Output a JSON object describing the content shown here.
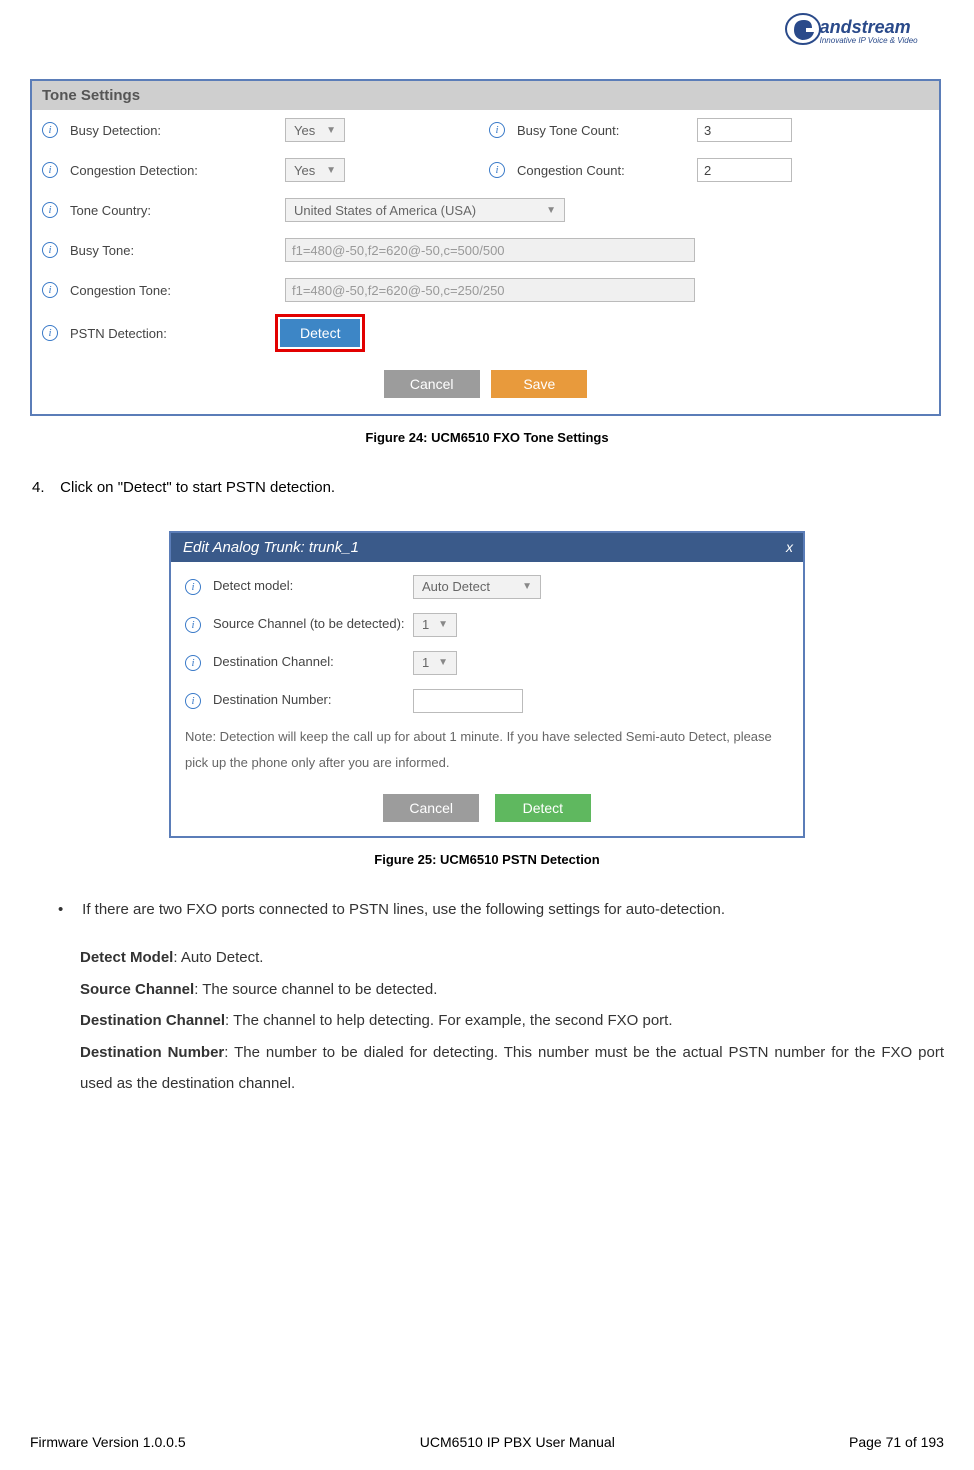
{
  "logo": {
    "brand": "andstream",
    "tagline": "Innovative IP Voice & Video"
  },
  "panel1": {
    "title": "Tone Settings",
    "rows": {
      "busy_detection": {
        "label": "Busy Detection:",
        "value": "Yes"
      },
      "busy_tone_count": {
        "label": "Busy Tone Count:",
        "value": "3"
      },
      "congestion_detection": {
        "label": "Congestion Detection:",
        "value": "Yes"
      },
      "congestion_count": {
        "label": "Congestion Count:",
        "value": "2"
      },
      "tone_country": {
        "label": "Tone Country:",
        "value": "United States of America (USA)"
      },
      "busy_tone": {
        "label": "Busy Tone:",
        "value": "f1=480@-50,f2=620@-50,c=500/500"
      },
      "congestion_tone": {
        "label": "Congestion Tone:",
        "value": "f1=480@-50,f2=620@-50,c=250/250"
      },
      "pstn_detection": {
        "label": "PSTN Detection:",
        "button": "Detect"
      }
    },
    "actions": {
      "cancel": "Cancel",
      "save": "Save"
    }
  },
  "fig24": "Figure 24: UCM6510 FXO Tone Settings",
  "instruction4": {
    "num": "4.",
    "text": "Click on \"Detect\" to start PSTN detection."
  },
  "panel2": {
    "title": "Edit Analog Trunk: trunk_1",
    "close": "x",
    "rows": {
      "detect_model": {
        "label": "Detect model:",
        "value": "Auto Detect"
      },
      "source_channel": {
        "label": "Source Channel (to be detected):",
        "value": "1"
      },
      "dest_channel": {
        "label": "Destination Channel:",
        "value": "1"
      },
      "dest_number": {
        "label": "Destination Number:",
        "value": ""
      }
    },
    "note": "Note: Detection will keep the call up for about 1 minute. If you have selected Semi-auto Detect, please pick up the phone only after you are informed.",
    "actions": {
      "cancel": "Cancel",
      "detect": "Detect"
    }
  },
  "fig25": "Figure 25: UCM6510 PSTN Detection",
  "bullet": "If there are two FXO ports connected to PSTN lines, use the following settings for auto-detection.",
  "defs": {
    "d1": {
      "term": "Detect Model",
      "text": ": Auto Detect."
    },
    "d2": {
      "term": "Source Channel",
      "text": ": The source channel to be detected."
    },
    "d3": {
      "term": "Destination Channel",
      "text": ": The channel to help detecting. For example, the second FXO port."
    },
    "d4": {
      "term": "Destination Number",
      "text": ": The number to be dialed for detecting. This number must be the actual PSTN number for the FXO port used as the destination channel."
    }
  },
  "footer": {
    "left": "Firmware Version 1.0.0.5",
    "center": "UCM6510 IP PBX User Manual",
    "right": "Page 71 of 193"
  }
}
